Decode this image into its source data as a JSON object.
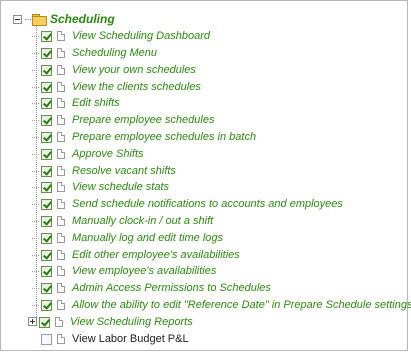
{
  "tree": {
    "root": {
      "label": "Scheduling",
      "expanded": true,
      "checked": true
    },
    "items": [
      {
        "label": "View Scheduling Dashboard",
        "checked": true
      },
      {
        "label": "Scheduling Menu",
        "checked": true
      },
      {
        "label": "View your own schedules",
        "checked": true
      },
      {
        "label": "View the clients schedules",
        "checked": true
      },
      {
        "label": "Edit shifts",
        "checked": true
      },
      {
        "label": "Prepare employee schedules",
        "checked": true
      },
      {
        "label": "Prepare employee schedules in batch",
        "checked": true
      },
      {
        "label": "Approve Shifts",
        "checked": true
      },
      {
        "label": "Resolve vacant shifts",
        "checked": true
      },
      {
        "label": "View schedule stats",
        "checked": true
      },
      {
        "label": "Send schedule notifications to accounts and employees",
        "checked": true
      },
      {
        "label": "Manually clock-in / out a shift",
        "checked": true
      },
      {
        "label": "Manually log and edit time logs",
        "checked": true
      },
      {
        "label": "Edit other employee's availabilities",
        "checked": true
      },
      {
        "label": "View employee's availabilities",
        "checked": true
      },
      {
        "label": "Admin Access Permissions to Schedules",
        "checked": true
      },
      {
        "label": "Allow the ability to edit \"Reference Date\" in Prepare Schedule settings",
        "checked": true
      },
      {
        "label": "View Scheduling Reports",
        "checked": true,
        "expandable": true
      },
      {
        "label": "View Labor Budget P&L",
        "checked": false
      }
    ]
  },
  "colors": {
    "checked_text": "#2d8a12",
    "unchecked_text": "#222222",
    "border": "#b8b8b8"
  },
  "icons": {
    "root": "folder-icon",
    "item": "document-icon",
    "expand": "expand-collapse-icon"
  }
}
